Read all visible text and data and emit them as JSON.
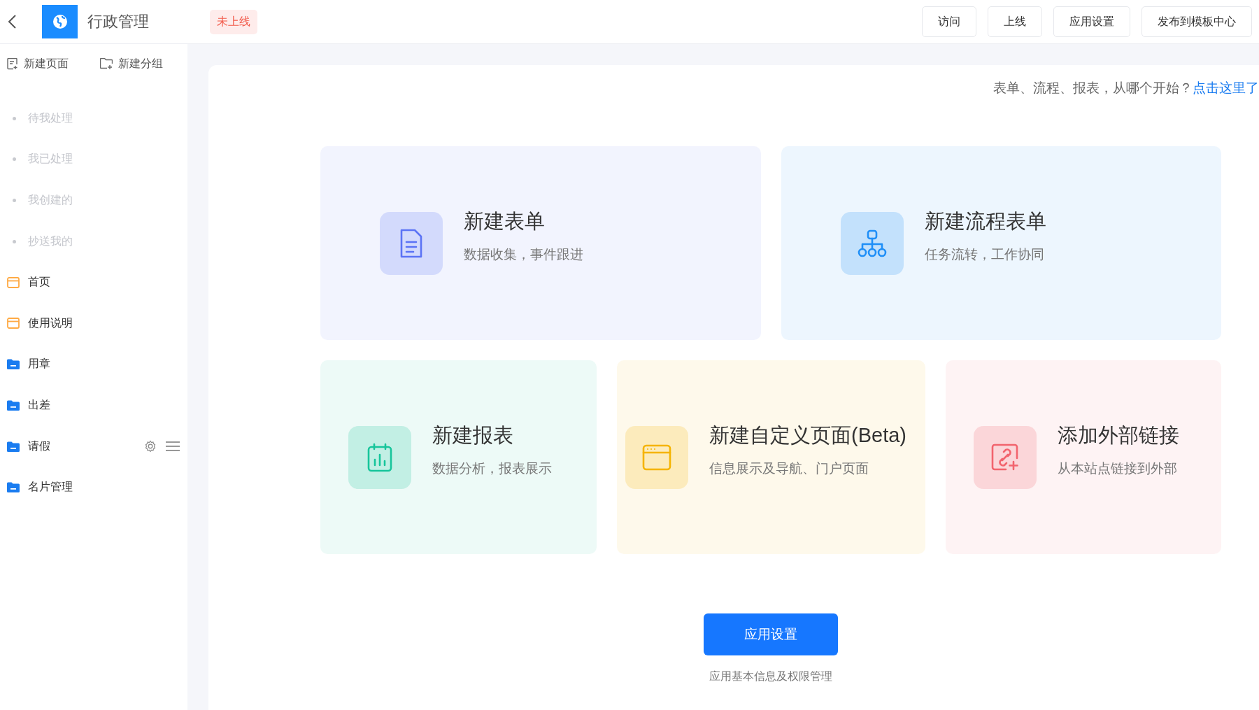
{
  "header": {
    "app_name": "行政管理",
    "status_badge": "未上线",
    "actions": [
      "访问",
      "上线",
      "应用设置",
      "发布到模板中心"
    ]
  },
  "sidebar": {
    "tools": [
      {
        "kind": "page",
        "label": "新建页面"
      },
      {
        "kind": "group",
        "label": "新建分组"
      }
    ],
    "items": [
      {
        "kind": "status",
        "label": "待我处理",
        "show_actions": false
      },
      {
        "kind": "status",
        "label": "我已处理",
        "show_actions": false
      },
      {
        "kind": "status",
        "label": "我创建的",
        "show_actions": false
      },
      {
        "kind": "status",
        "label": "抄送我的",
        "show_actions": false
      },
      {
        "kind": "page",
        "label": "首页",
        "show_actions": false
      },
      {
        "kind": "page",
        "label": "使用说明",
        "show_actions": false
      },
      {
        "kind": "group",
        "label": "用章",
        "show_actions": false
      },
      {
        "kind": "group",
        "label": "出差",
        "show_actions": false
      },
      {
        "kind": "group",
        "label": "请假",
        "show_actions": true
      },
      {
        "kind": "group",
        "label": "名片管理",
        "show_actions": false
      }
    ]
  },
  "main": {
    "hint": "表单、流程、报表，从哪个开始？",
    "hint_link": "点击这里了",
    "cards_top": [
      {
        "kind": "form",
        "title": "新建表单",
        "subtitle": "数据收集，事件跟进",
        "color": "#5b73f5"
      },
      {
        "kind": "flow",
        "title": "新建流程表单",
        "subtitle": "任务流转，工作协同",
        "color": "#1f8ff7"
      }
    ],
    "cards_bottom": [
      {
        "kind": "report",
        "title": "新建报表",
        "subtitle": "数据分析，报表展示",
        "color": "#17c59b"
      },
      {
        "kind": "page",
        "title": "新建自定义页面(Beta)",
        "subtitle": "信息展示及导航、门户页面",
        "color": "#f5b400"
      },
      {
        "kind": "link",
        "title": "添加外部链接",
        "subtitle": "从本站点链接到外部",
        "color": "#f2646e"
      }
    ],
    "settings_button": "应用设置",
    "settings_caption": "应用基本信息及权限管理"
  }
}
